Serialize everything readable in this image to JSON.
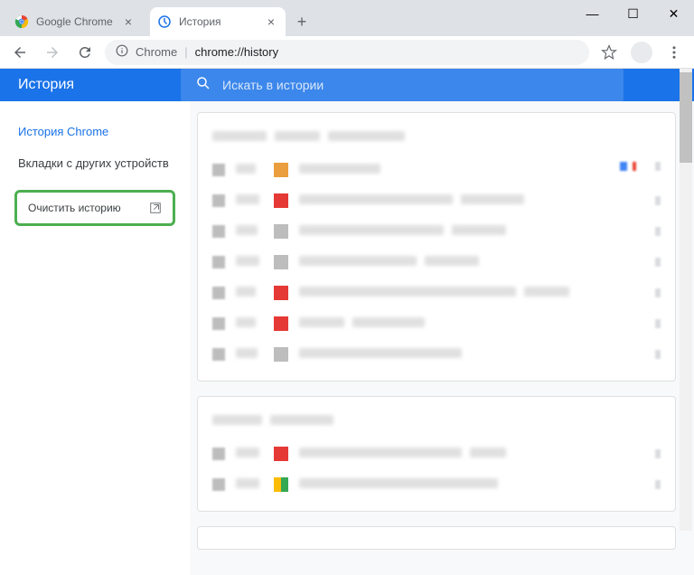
{
  "window": {
    "minimize": "—",
    "maximize": "☐",
    "close": "✕"
  },
  "tabs": [
    {
      "title": "Google Chrome",
      "active": false
    },
    {
      "title": "История",
      "active": true
    }
  ],
  "addressbar": {
    "secure_label": "Chrome",
    "url": "chrome://history"
  },
  "header": {
    "title": "История",
    "search_placeholder": "Искать в истории"
  },
  "sidebar": {
    "items": [
      {
        "label": "История Chrome",
        "active": true
      },
      {
        "label": "Вкладки с других устройств",
        "active": false
      }
    ],
    "clear_label": "Очистить историю"
  }
}
